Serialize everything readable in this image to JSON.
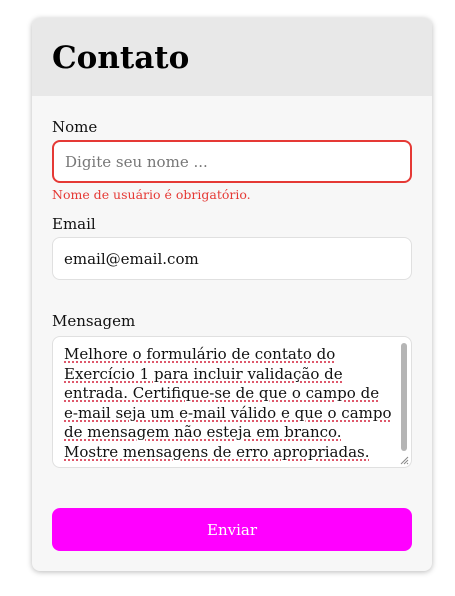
{
  "form": {
    "title": "Contato",
    "name": {
      "label": "Nome",
      "value": "",
      "placeholder": "Digite seu nome ...",
      "error": "Nome de usuário é obrigatório."
    },
    "email": {
      "label": "Email",
      "value": "email@email.com",
      "placeholder": ""
    },
    "message": {
      "label": "Mensagem",
      "value": "Melhore o formulário de contato do Exercício 1 para incluir validação de entrada. Certifique-se de que o campo de e-mail seja um e-mail válido e que o campo de mensagem não esteja em branco. Mostre mensagens de erro apropriadas."
    },
    "submit_label": "Enviar"
  },
  "colors": {
    "accent": "#ff00ff",
    "error": "#e53935",
    "header_bg": "#e8e8e8",
    "card_bg": "#f7f7f7"
  }
}
